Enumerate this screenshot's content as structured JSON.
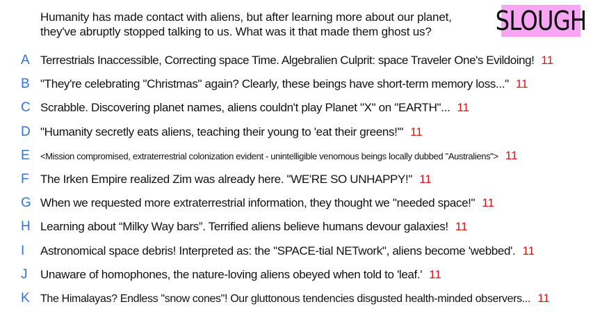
{
  "prompt": {
    "line1": "Humanity has made contact with aliens, but after learning more about our planet,",
    "line2": "they've abruptly stopped talking to us. What was it that made them ghost us?"
  },
  "badge": {
    "label": "SLOUGH",
    "color": "#f7a6f3"
  },
  "colors": {
    "letter": "#2f73d6",
    "votes": "#e11111",
    "text": "#111111"
  },
  "answers": [
    {
      "letter": "A",
      "text": "Terrestrials Inaccessible, Correcting space Time. Algebralien Culprit: space Traveler One's Evildoing!",
      "votes": "11"
    },
    {
      "letter": "B",
      "text": "\"They're celebrating \"Christmas\" again? Clearly, these beings have short-term memory loss...\"",
      "votes": "11"
    },
    {
      "letter": "C",
      "text": "Scrabble. Discovering planet names, aliens couldn't play Planet \"X\" on \"EARTH\"...",
      "votes": "11"
    },
    {
      "letter": "D",
      "text": "\"Humanity secretly eats aliens, teaching their young to 'eat their greens!'\"",
      "votes": "11"
    },
    {
      "letter": "E",
      "text": "<Mission compromised, extraterrestrial colonization evident - unintelligible venomous beings locally dubbed \"Australiens\">",
      "votes": "11"
    },
    {
      "letter": "F",
      "text": "The Irken Empire realized Zim was already here. \"WE'RE SO UNHAPPY!\"",
      "votes": "11"
    },
    {
      "letter": "G",
      "text": "When we requested more extraterrestrial information, they thought we \"needed space!\"",
      "votes": "11"
    },
    {
      "letter": "H",
      "text": "Learning about “Milky Way bars”. Terrified aliens believe humans devour galaxies!",
      "votes": "11"
    },
    {
      "letter": "I",
      "text": "Astronomical space debris! Interpreted as: the \"SPACE-tial NETwork\", aliens become 'webbed'.",
      "votes": "11"
    },
    {
      "letter": "J",
      "text": "Unaware of homophones, the nature-loving aliens obeyed when told to 'leaf.'",
      "votes": "11"
    },
    {
      "letter": "K",
      "text": "The Himalayas? Endless \"snow cones\"! Our gluttonous tendencies disgusted health-minded observers...",
      "votes": "11"
    }
  ]
}
